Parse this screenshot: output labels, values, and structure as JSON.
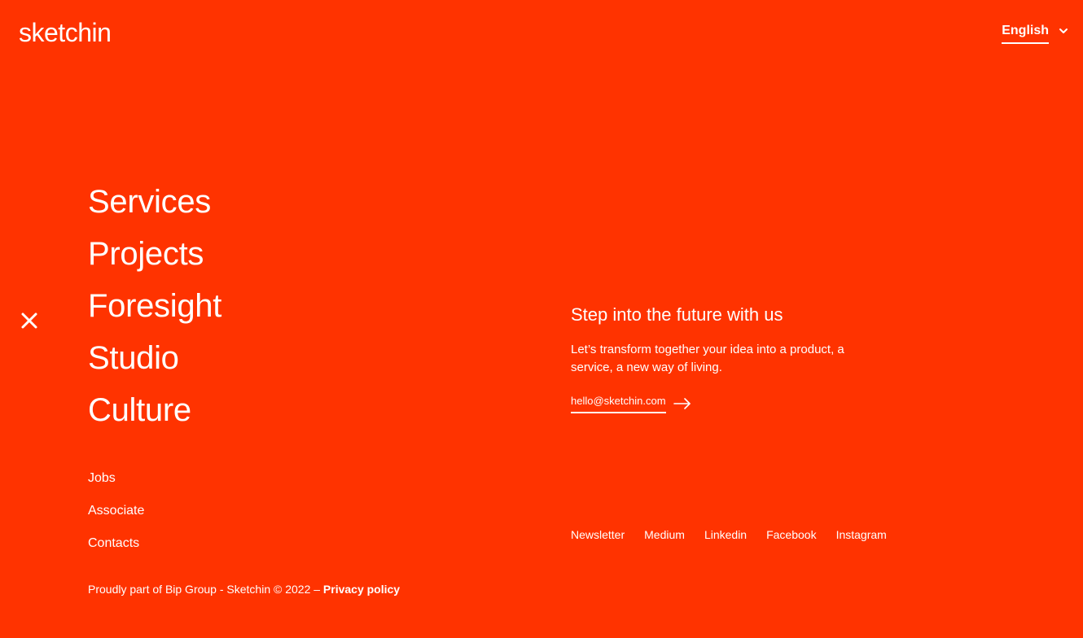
{
  "header": {
    "logo": "sketchin",
    "language": "English"
  },
  "icons": {
    "chevron": "chevron-down-icon",
    "close": "close-icon",
    "arrow": "arrow-right-icon"
  },
  "main_nav": [
    {
      "label": "Services"
    },
    {
      "label": "Projects"
    },
    {
      "label": "Foresight"
    },
    {
      "label": "Studio"
    },
    {
      "label": "Culture"
    }
  ],
  "sub_nav": [
    {
      "label": "Jobs"
    },
    {
      "label": "Associate"
    },
    {
      "label": "Contacts"
    }
  ],
  "footer": {
    "note": "Proudly part of Bip Group - Sketchin © 2022 – ",
    "privacy": "Privacy policy"
  },
  "cta": {
    "title": "Step into the future with us",
    "text": "Let’s transform together your idea into a product, a service, a new way of living.",
    "email": "hello@sketchin.com"
  },
  "social": [
    {
      "label": "Newsletter"
    },
    {
      "label": "Medium"
    },
    {
      "label": "Linkedin"
    },
    {
      "label": "Facebook"
    },
    {
      "label": "Instagram"
    }
  ],
  "colors": {
    "background": "#ff3300",
    "foreground": "#ffffff"
  }
}
